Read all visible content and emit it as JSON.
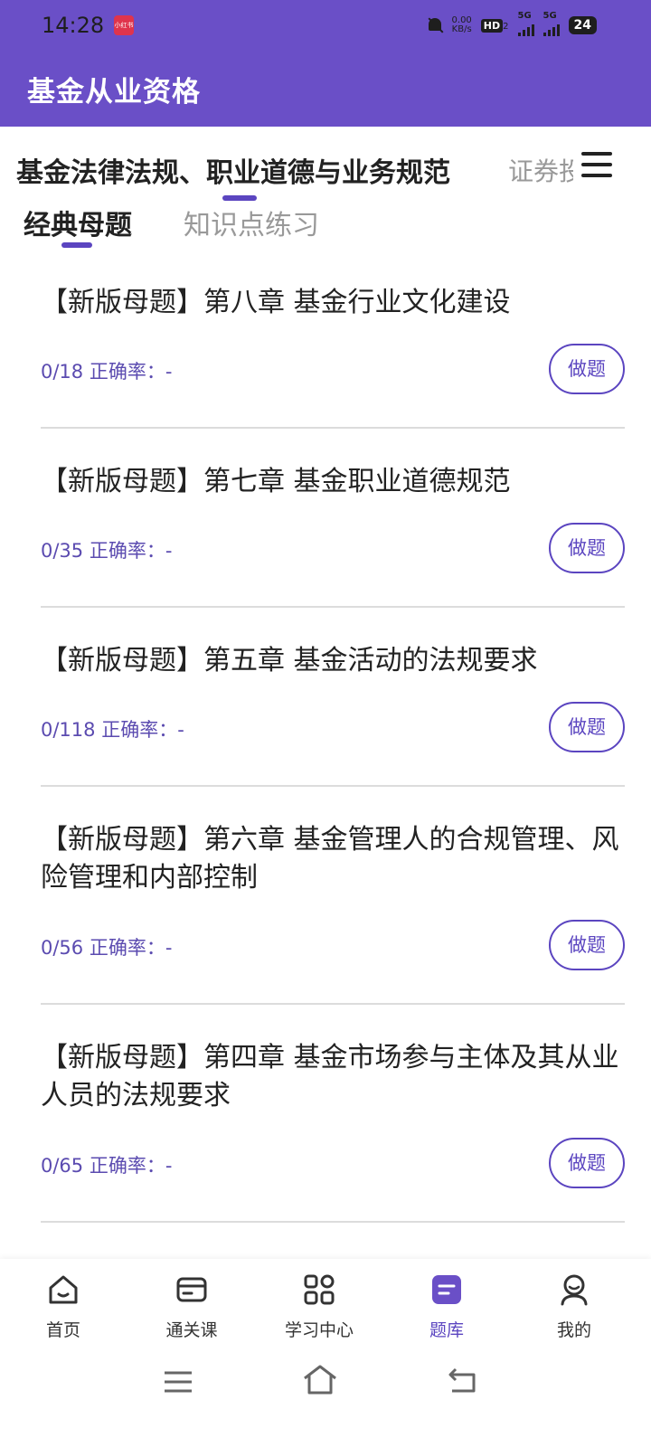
{
  "status": {
    "time": "14:28",
    "app_badge": "小红书",
    "net_speed": "0.00",
    "net_unit": "KB/s",
    "hd": "HD",
    "hd_sub": "2",
    "sig1": "5G",
    "sig2": "5G",
    "battery": "24"
  },
  "header": {
    "title": "基金从业资格"
  },
  "subjects": {
    "active": "基金法律法规、职业道德与业务规范",
    "next": "证券投"
  },
  "subtabs": {
    "active": "经典母题",
    "other": "知识点练习"
  },
  "items": [
    {
      "title": "【新版母题】第八章 基金行业文化建设",
      "meta": "0/18 正确率：-",
      "button": "做题"
    },
    {
      "title": "【新版母题】第七章 基金职业道德规范",
      "meta": "0/35 正确率：-",
      "button": "做题"
    },
    {
      "title": "【新版母题】第五章 基金活动的法规要求",
      "meta": "0/118 正确率：-",
      "button": "做题"
    },
    {
      "title": "【新版母题】第六章 基金管理人的合规管理、风险管理和内部控制",
      "meta": "0/56 正确率：-",
      "button": "做题"
    },
    {
      "title": "【新版母题】第四章 基金市场参与主体及其从业人员的法规要求",
      "meta": "0/65 正确率：-",
      "button": "做题"
    }
  ],
  "nav": [
    {
      "label": "首页",
      "icon": "home-icon"
    },
    {
      "label": "通关课",
      "icon": "card-icon"
    },
    {
      "label": "学习中心",
      "icon": "grid-icon"
    },
    {
      "label": "题库",
      "icon": "question-bank-icon"
    },
    {
      "label": "我的",
      "icon": "profile-icon"
    }
  ],
  "colors": {
    "accent": "#6a4fc7",
    "primary": "#5b45c0"
  }
}
